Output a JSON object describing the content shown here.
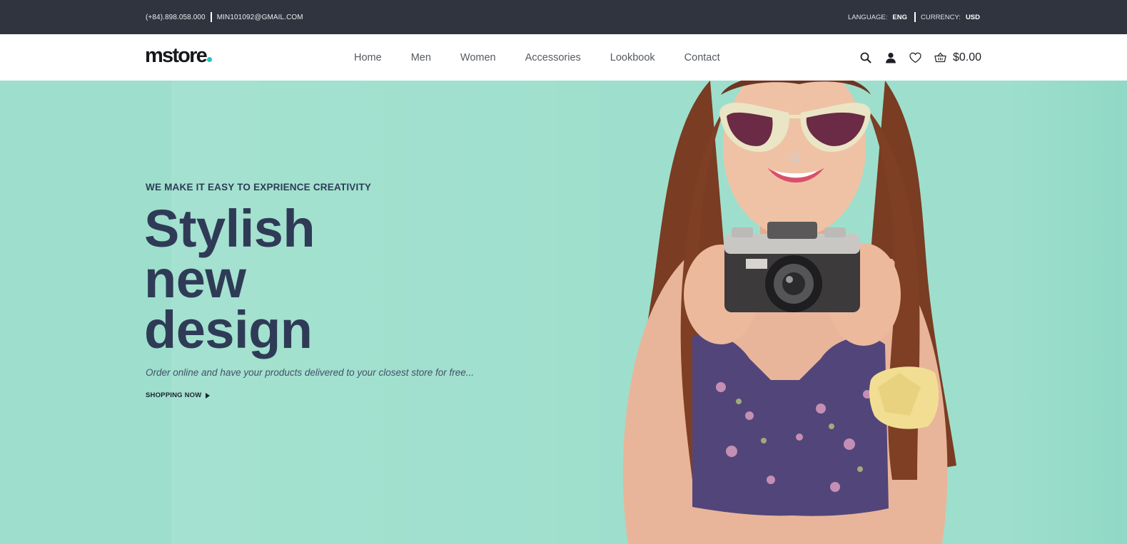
{
  "topbar": {
    "phone": "(+84).898.058.000",
    "email": "MIN101092@GMAIL.COM",
    "language_label": "LANGUAGE:",
    "language_value": "ENG",
    "currency_label": "CURRENCY:",
    "currency_value": "USD"
  },
  "header": {
    "logo": "mstore",
    "nav": [
      "Home",
      "Men",
      "Women",
      "Accessories",
      "Lookbook",
      "Contact"
    ],
    "cart_total": "$0.00",
    "icons": [
      "search-icon",
      "user-icon",
      "heart-icon",
      "basket-icon"
    ]
  },
  "hero": {
    "tagline": "WE MAKE IT EASY TO EXPRIENCE CREATIVITY",
    "headline_line1": "Stylish",
    "headline_line2": "new",
    "headline_line3": "design",
    "subtitle": "Order online and have your products delivered to your closest store for free...",
    "cta": "SHOPPING NOW",
    "background_color": "#9ddfcc",
    "heading_color": "#2f3b56"
  }
}
